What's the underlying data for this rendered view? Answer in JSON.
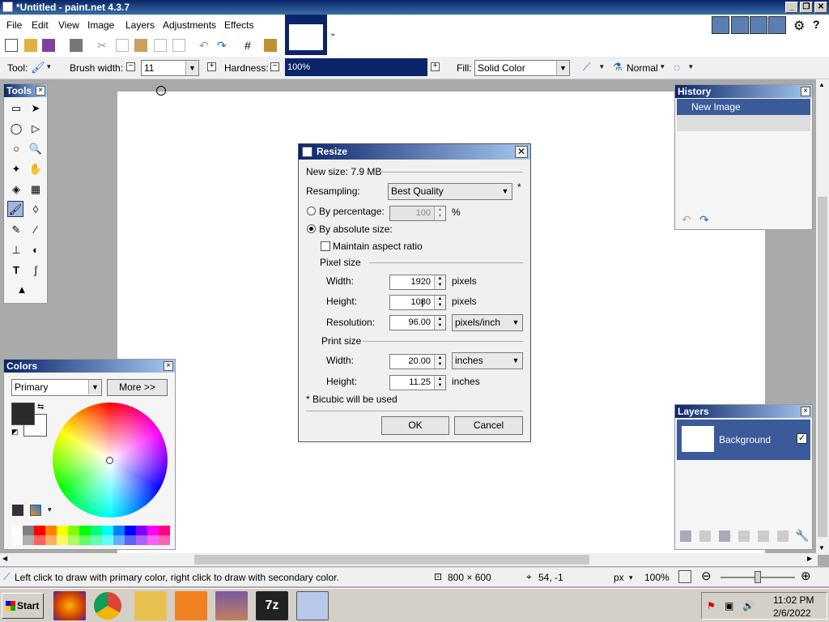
{
  "window": {
    "title": "*Untitled - paint.net 4.3.7",
    "minimize": "_",
    "restore": "❐",
    "close": "✕"
  },
  "menu": [
    "File",
    "Edit",
    "View",
    "Image",
    "Layers",
    "Adjustments",
    "Effects"
  ],
  "toolbar": {
    "tool_label": "Tool:",
    "brush_width_label": "Brush width:",
    "brush_width_value": "11",
    "hardness_label": "Hardness:",
    "hardness_value": "100%",
    "fill_label": "Fill:",
    "fill_value": "Solid Color",
    "blend_mode": "Normal"
  },
  "tools_panel": {
    "title": "Tools"
  },
  "history_panel": {
    "title": "History",
    "items": [
      "New Image"
    ]
  },
  "colors_panel": {
    "title": "Colors",
    "mode": "Primary",
    "more_button": "More >>",
    "palette": [
      "#ffffff",
      "#808080",
      "#ff0000",
      "#ff8000",
      "#ffff00",
      "#80ff00",
      "#00ff00",
      "#00ff80",
      "#00ffff",
      "#0080ff",
      "#0000ff",
      "#8000ff",
      "#ff00ff",
      "#ff0080"
    ]
  },
  "layers_panel": {
    "title": "Layers",
    "items": [
      "Background"
    ]
  },
  "dialog": {
    "title": "Resize",
    "new_size": "New size: 7.9 MB",
    "resampling_label": "Resampling:",
    "resampling_value": "Best Quality",
    "asterisk": "*",
    "by_percentage": "By percentage:",
    "percentage_value": "100",
    "percent_sign": "%",
    "by_absolute": "By absolute size:",
    "maintain_aspect": "Maintain aspect ratio",
    "pixel_size_label": "Pixel size",
    "width_label": "Width:",
    "width_value": "1920",
    "height_label": "Height:",
    "height_value": "1080",
    "pixels_unit": "pixels",
    "resolution_label": "Resolution:",
    "resolution_value": "96.00",
    "resolution_unit": "pixels/inch",
    "print_size_label": "Print size",
    "print_width_value": "20.00",
    "print_width_unit": "inches",
    "print_height_value": "11.25",
    "print_height_unit": "inches",
    "bicubic_note": "* Bicubic will be used",
    "ok": "OK",
    "cancel": "Cancel"
  },
  "status": {
    "hint": "Left click to draw with primary color, right click to draw with secondary color.",
    "image_size": "800 × 600",
    "cursor_pos": "54, -1",
    "units": "px",
    "zoom": "100%"
  },
  "taskbar": {
    "start": "Start",
    "time": "11:02 PM",
    "date": "2/6/2022",
    "sevenzip_label": "7z"
  }
}
